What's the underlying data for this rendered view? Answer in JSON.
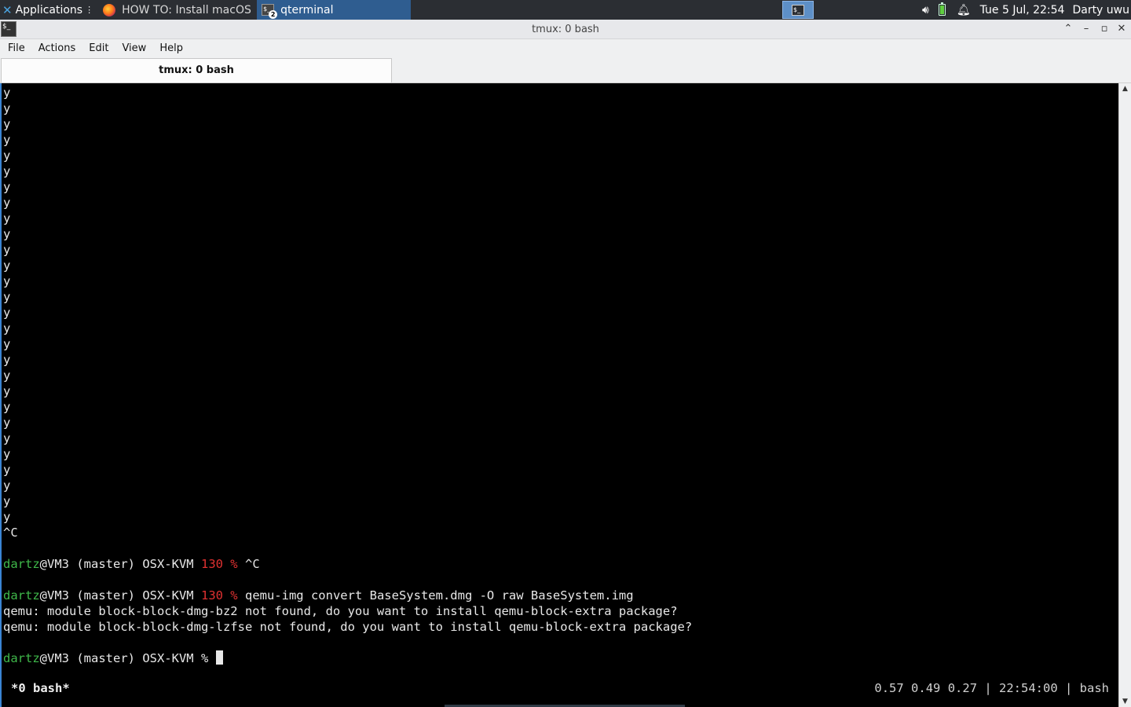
{
  "panel": {
    "apps_label": "Applications",
    "apps_icon": "xfce-logo-icon",
    "tasks": [
      {
        "label": "HOW TO: Install macOS ...",
        "icon": "firefox-icon"
      },
      {
        "label": "qterminal",
        "icon": "terminal-icon",
        "badge": "2",
        "active": true
      }
    ],
    "clock": "Tue  5 Jul, 22:54",
    "user": "Darty uwu",
    "tray_icons": [
      "volume-icon",
      "battery-icon",
      "notification-bell-icon"
    ]
  },
  "window": {
    "title": "tmux: 0 bash",
    "buttons": [
      "shade",
      "minimize",
      "maximize",
      "close"
    ]
  },
  "menubar": {
    "items": [
      "File",
      "Actions",
      "Edit",
      "View",
      "Help"
    ]
  },
  "tabs": [
    {
      "label": "tmux: 0 bash",
      "active": true
    }
  ],
  "terminal": {
    "lines": [
      {
        "text": "y"
      },
      {
        "text": "y"
      },
      {
        "text": "y"
      },
      {
        "text": "y"
      },
      {
        "text": "y"
      },
      {
        "text": "y"
      },
      {
        "text": "y"
      },
      {
        "text": "y"
      },
      {
        "text": "y"
      },
      {
        "text": "y"
      },
      {
        "text": "y"
      },
      {
        "text": "y"
      },
      {
        "text": "y"
      },
      {
        "text": "y"
      },
      {
        "text": "y"
      },
      {
        "text": "y"
      },
      {
        "text": "y"
      },
      {
        "text": "y"
      },
      {
        "text": "y"
      },
      {
        "text": "y"
      },
      {
        "text": "y"
      },
      {
        "text": "y"
      },
      {
        "text": "y"
      },
      {
        "text": "y"
      },
      {
        "text": "y"
      },
      {
        "text": "y"
      },
      {
        "text": "y"
      },
      {
        "text": "y"
      },
      {
        "text": "^C"
      },
      {
        "text": ""
      },
      {
        "prompt": {
          "user": "dartz",
          "host": "@VM3 (master) OSX-KVM ",
          "code": "130 % ",
          "cmd": "^C"
        }
      },
      {
        "text": ""
      },
      {
        "prompt": {
          "user": "dartz",
          "host": "@VM3 (master) OSX-KVM ",
          "code": "130 % ",
          "cmd": "qemu-img convert BaseSystem.dmg -O raw BaseSystem.img"
        }
      },
      {
        "text": "qemu: module block-block-dmg-bz2 not found, do you want to install qemu-block-extra package?"
      },
      {
        "text": "qemu: module block-block-dmg-lzfse not found, do you want to install qemu-block-extra package?"
      },
      {
        "text": ""
      },
      {
        "prompt": {
          "user": "dartz",
          "host": "@VM3 (master) OSX-KVM % ",
          "code": "",
          "cmd": ""
        },
        "cursor": true
      }
    ],
    "status_left": "*0 bash*",
    "status_right": "0.57 0.49 0.27 | 22:54:00 | bash"
  },
  "colors": {
    "panel_bg": "#2b2e33",
    "active_task": "#2f5d90",
    "prompt_user": "#3fb84a",
    "exit_code": "#e03131",
    "terminal_bg": "#000000"
  }
}
